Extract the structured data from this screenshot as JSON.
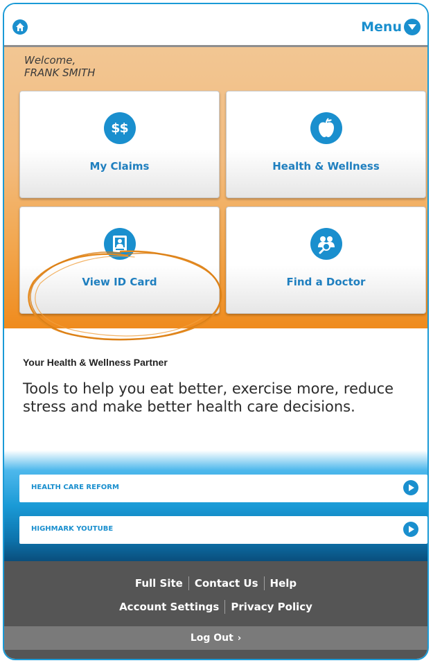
{
  "header": {
    "menu_label": "Menu"
  },
  "welcome": {
    "line1": "Welcome,",
    "line2": "FRANK SMITH"
  },
  "tiles": [
    {
      "label": "My Claims",
      "icon": "dollar-icon",
      "icon_text": "$$"
    },
    {
      "label": "Health & Wellness",
      "icon": "apple-icon"
    },
    {
      "label": "View ID Card",
      "icon": "id-card-icon"
    },
    {
      "label": "Find a Doctor",
      "icon": "doctor-search-icon"
    }
  ],
  "partner": {
    "title": "Your Health & Wellness Partner",
    "description": "Tools to help you eat better, exercise more, reduce stress and make better health care decisions."
  },
  "links": [
    {
      "label": "HEALTH CARE REFORM",
      "icon": "arrow-right-icon"
    },
    {
      "label": "HIGHMARK YOUTUBE",
      "icon": "arrow-right-icon"
    }
  ],
  "footer": {
    "full_site": "Full Site",
    "contact_us": "Contact Us",
    "help": "Help",
    "account_settings": "Account Settings",
    "privacy_policy": "Privacy Policy",
    "log_out": "Log Out",
    "log_out_chevron": "›"
  },
  "colors": {
    "accent_blue": "#1a8fce",
    "frame_blue": "#1a9ad6",
    "hero_orange": "#ef8b1d",
    "footer_gray": "#555555"
  }
}
